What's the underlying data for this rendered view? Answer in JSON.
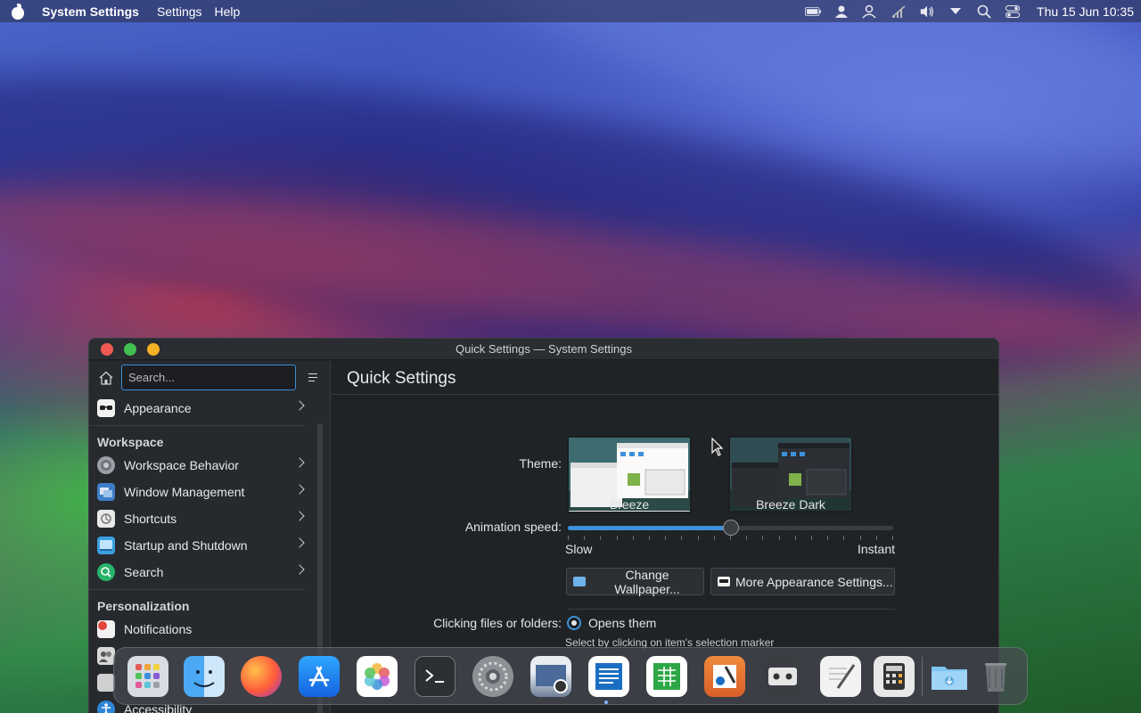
{
  "menubar": {
    "app_name": "System Settings",
    "menus": [
      "Settings",
      "Help"
    ],
    "clock": "Thu 15 Jun 10:35",
    "tray_icons": [
      "battery-icon",
      "user-icon",
      "user-switch-icon",
      "network-muted-icon",
      "volume-icon",
      "dropdown-icon",
      "search-icon",
      "control-center-icon"
    ]
  },
  "window": {
    "title": "Quick Settings — System Settings",
    "search_placeholder": "Search...",
    "sidebar": {
      "top_items": [
        {
          "label": "Appearance",
          "icon": "appearance-icon"
        }
      ],
      "workspace_label": "Workspace",
      "workspace_items": [
        {
          "label": "Workspace Behavior",
          "icon": "workspace-behavior-icon"
        },
        {
          "label": "Window Management",
          "icon": "window-management-icon"
        },
        {
          "label": "Shortcuts",
          "icon": "shortcuts-icon"
        },
        {
          "label": "Startup and Shutdown",
          "icon": "startup-icon"
        },
        {
          "label": "Search",
          "icon": "search-icon"
        }
      ],
      "personalization_label": "Personalization",
      "personalization_items": [
        {
          "label": "Notifications",
          "icon": "notifications-icon"
        },
        {
          "label": "",
          "icon": "users-icon"
        },
        {
          "label": "",
          "icon": "regional-icon"
        },
        {
          "label": "Accessibility",
          "icon": "accessibility-icon"
        }
      ]
    },
    "main": {
      "heading": "Quick Settings",
      "theme_label": "Theme:",
      "themes": [
        "Breeze",
        "Breeze Dark"
      ],
      "animation_label": "Animation speed:",
      "animation_slow": "Slow",
      "animation_instant": "Instant",
      "animation_value": 0.5,
      "change_wallpaper": "Change Wallpaper...",
      "more_appearance": "More Appearance Settings...",
      "clicking_label": "Clicking files or folders:",
      "clicking_option": "Opens them",
      "clicking_hint": "Select by clicking on item's selection marker"
    }
  },
  "dock": {
    "apps": [
      "launchpad-icon",
      "finder-icon",
      "firefox-icon",
      "app-store-icon",
      "photos-icon",
      "terminal-icon",
      "system-settings-icon",
      "screenshot-icon",
      "writer-icon",
      "calc-icon",
      "draw-icon",
      "cassette-icon",
      "text-editor-icon",
      "calculator-icon",
      "downloads-folder-icon",
      "trash-icon"
    ]
  },
  "colors": {
    "accent": "#3d90d9",
    "close": "#ee5a52",
    "minimize": "#42c052",
    "maximize": "#f3b225"
  }
}
